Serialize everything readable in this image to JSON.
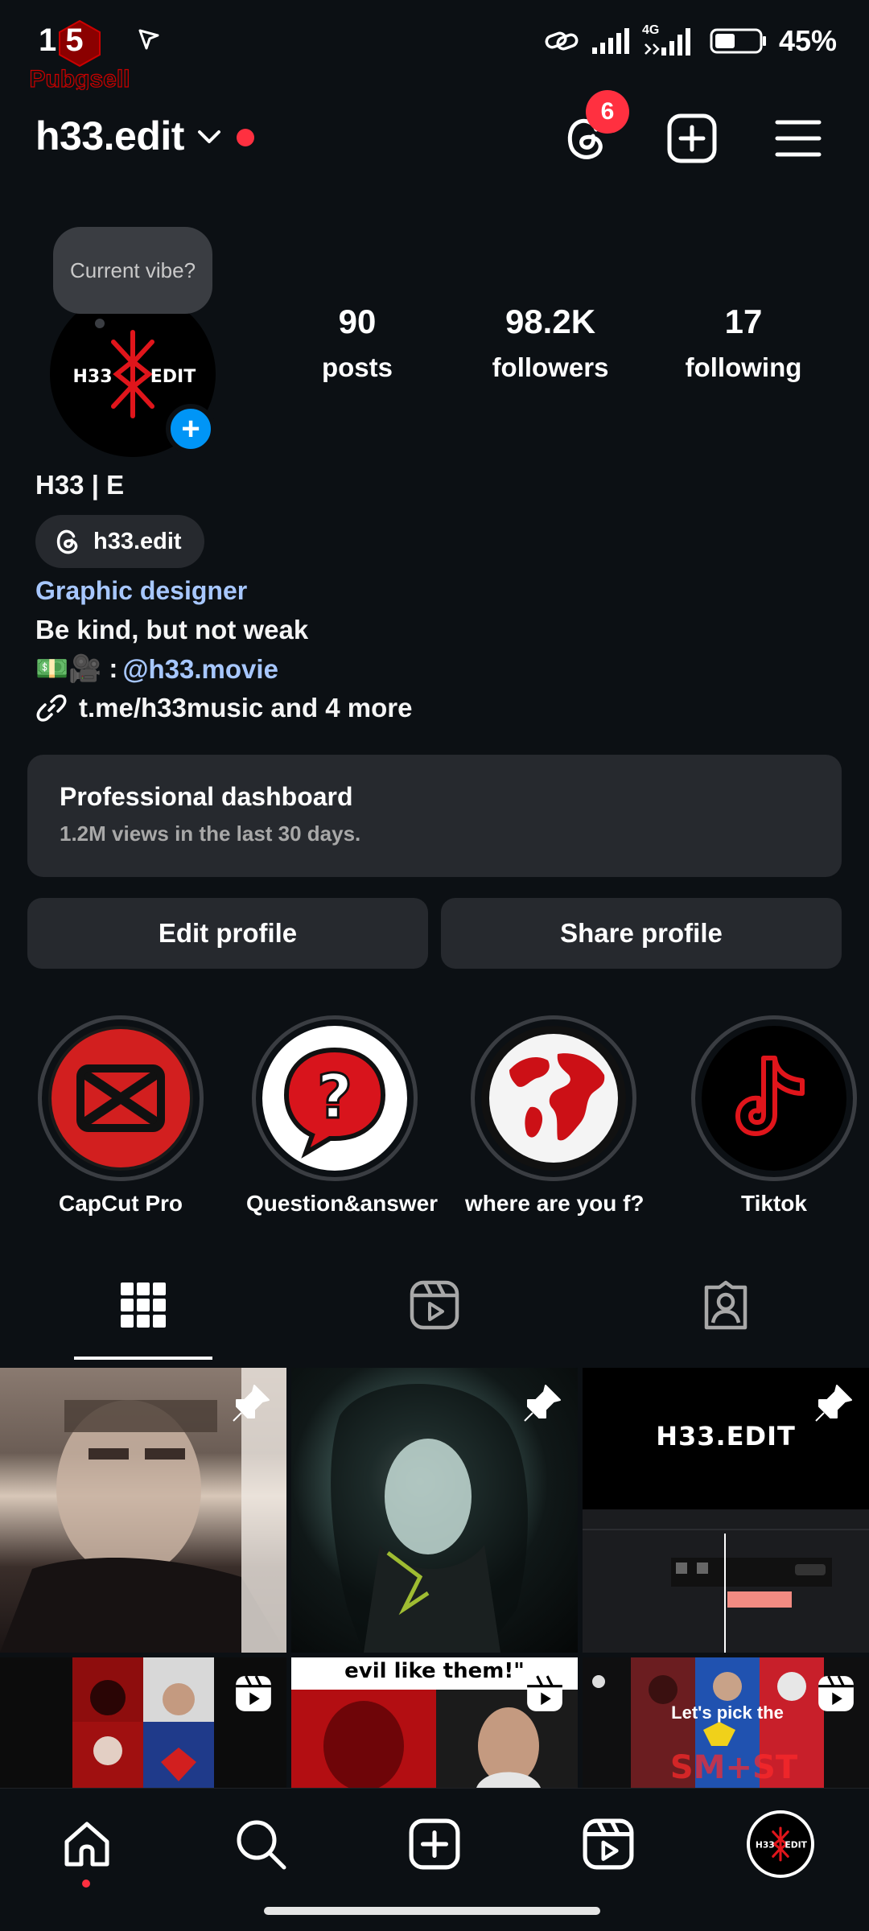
{
  "status_bar": {
    "time": "1  5",
    "network": "4G",
    "battery": "45%",
    "watermark_text": "Pubgsell"
  },
  "header": {
    "username": "h33.edit",
    "threads_badge": "6"
  },
  "profile": {
    "note": "Current vibe?",
    "logo_text": "H33 EDIT",
    "stats": [
      {
        "value": "90",
        "label": "posts"
      },
      {
        "value": "98.2K",
        "label": "followers"
      },
      {
        "value": "17",
        "label": "following"
      }
    ],
    "display_name": "H33 | E",
    "threads_handle": "h33.edit",
    "category": "Graphic designer",
    "bio_line1": "Be kind, but not weak",
    "bio_line2_emoji": "💵🎥 :",
    "bio_line2_mention": "@h33.movie",
    "link": "t.me/h33music and 4 more"
  },
  "dashboard": {
    "title": "Professional dashboard",
    "subtitle": "1.2M views in the last 30 days."
  },
  "buttons": {
    "edit": "Edit profile",
    "share": "Share profile"
  },
  "highlights": [
    {
      "label": "CapCut Pro"
    },
    {
      "label": "Question&answer"
    },
    {
      "label": "where are you f?"
    },
    {
      "label": "Tiktok"
    }
  ],
  "grid": {
    "post3_title": "H33.EDIT",
    "post5_caption": "evil like them!\"",
    "post6_caption": "Let's pick the"
  },
  "colors": {
    "background": "#0c1014",
    "surface": "#26292e",
    "accent_blue": "#0095f6",
    "link_blue": "#a7c7ff",
    "notification_red": "#ff3040"
  }
}
